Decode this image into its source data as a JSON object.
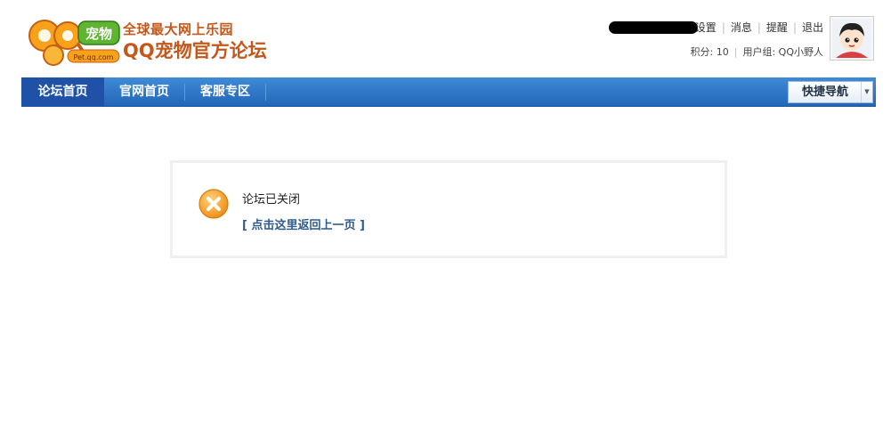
{
  "logo": {
    "mark_text": "宠物",
    "mark_sub": "Pet.qq.com",
    "tagline": "全球最大网上乐园",
    "title": "QQ宠物官方论坛"
  },
  "user_links": [
    "设置",
    "消息",
    "提醒",
    "退出"
  ],
  "user_info": {
    "points": "积分: 10",
    "group": "用户组: QQ小野人"
  },
  "nav": {
    "items": [
      "论坛首页",
      "官网首页",
      "客服专区"
    ],
    "quick_nav": "快捷导航"
  },
  "message": {
    "title": "论坛已关闭",
    "back_link": "[ 点击这里返回上一页 ]"
  },
  "colors": {
    "brand": "#c4581a",
    "nav_bg": "#2a72c4",
    "nav_active": "#1f52a6",
    "link": "#2c5b8e",
    "error_icon": "#f39c12"
  }
}
